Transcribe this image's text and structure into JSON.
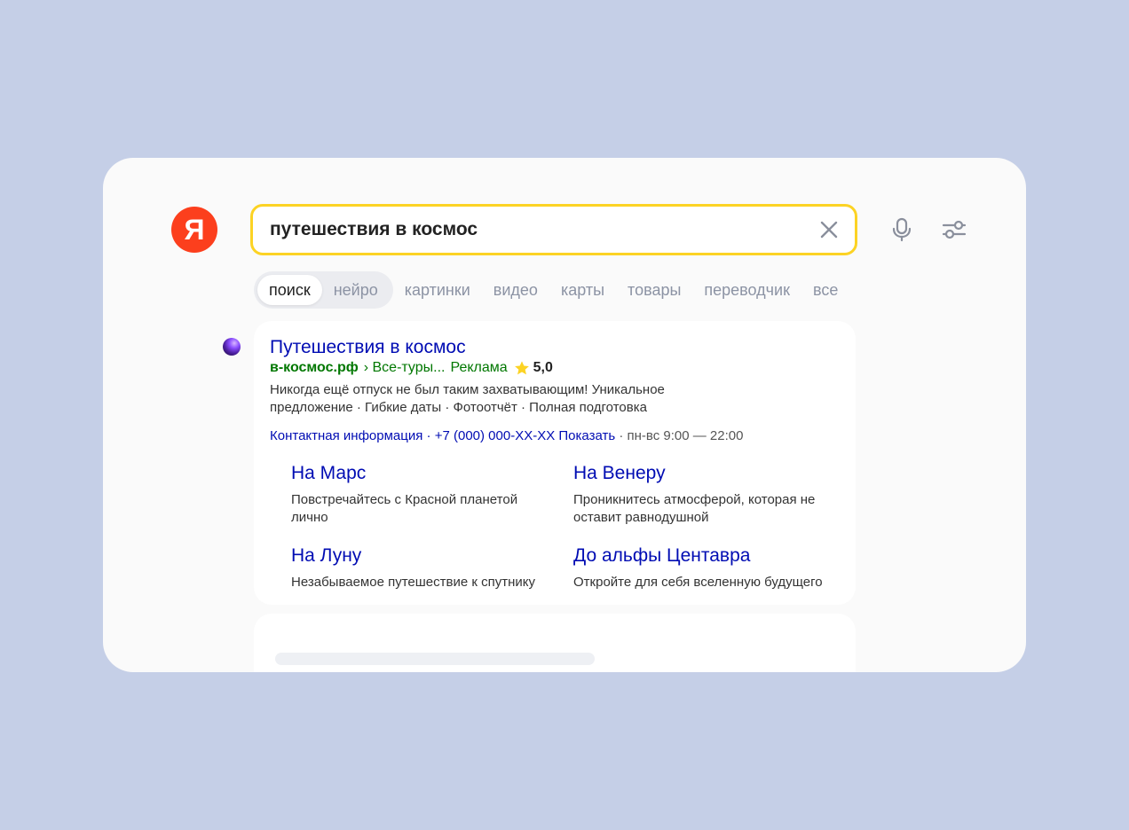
{
  "logo": {
    "letter": "Я"
  },
  "search": {
    "query": "путешествия в космос"
  },
  "colors": {
    "background": "#c5cfe7",
    "logo": "#fc3f1d",
    "search_border": "#fcd324",
    "link": "#000cb3",
    "url": "#007700",
    "star": "#fcd324"
  },
  "icons": {
    "clear": "close-icon",
    "mic": "microphone-icon",
    "settings": "filter-settings-icon",
    "star": "star-icon"
  },
  "tabs": [
    {
      "label": "поиск",
      "active": true
    },
    {
      "label": "нейро",
      "active": false
    },
    {
      "label": "картинки",
      "active": false
    },
    {
      "label": "видео",
      "active": false
    },
    {
      "label": "карты",
      "active": false
    },
    {
      "label": "товары",
      "active": false
    },
    {
      "label": "переводчик",
      "active": false
    },
    {
      "label": "все",
      "active": false
    }
  ],
  "result": {
    "title": "Путешествия в космос",
    "domain": "в-космос.рф",
    "path": "› Все-туры...",
    "ad_label": "Реклама",
    "rating": "5,0",
    "description": "Никогда ещё отпуск не был таким захватывающим! Уникальное предложение · Гибкие даты · Фотоотчёт · Полная подготовка",
    "contacts": "Контактная информация",
    "separator": "·",
    "phone": "+7 (000) 000-XX-XX",
    "phone_action": "Показать",
    "hours": "· пн-вс 9:00 — 22:00",
    "sitelinks": [
      {
        "title": "На Марс",
        "desc": "Повстречайтесь с Красной планетой лично"
      },
      {
        "title": "На Венеру",
        "desc": "Проникнитесь атмосферой, которая не оставит равнодушной"
      },
      {
        "title": "На Луну",
        "desc": "Незабываемое путешествие к спутнику"
      },
      {
        "title": "До альфы Центавра",
        "desc": "Откройте для себя вселенную будущего"
      }
    ]
  }
}
